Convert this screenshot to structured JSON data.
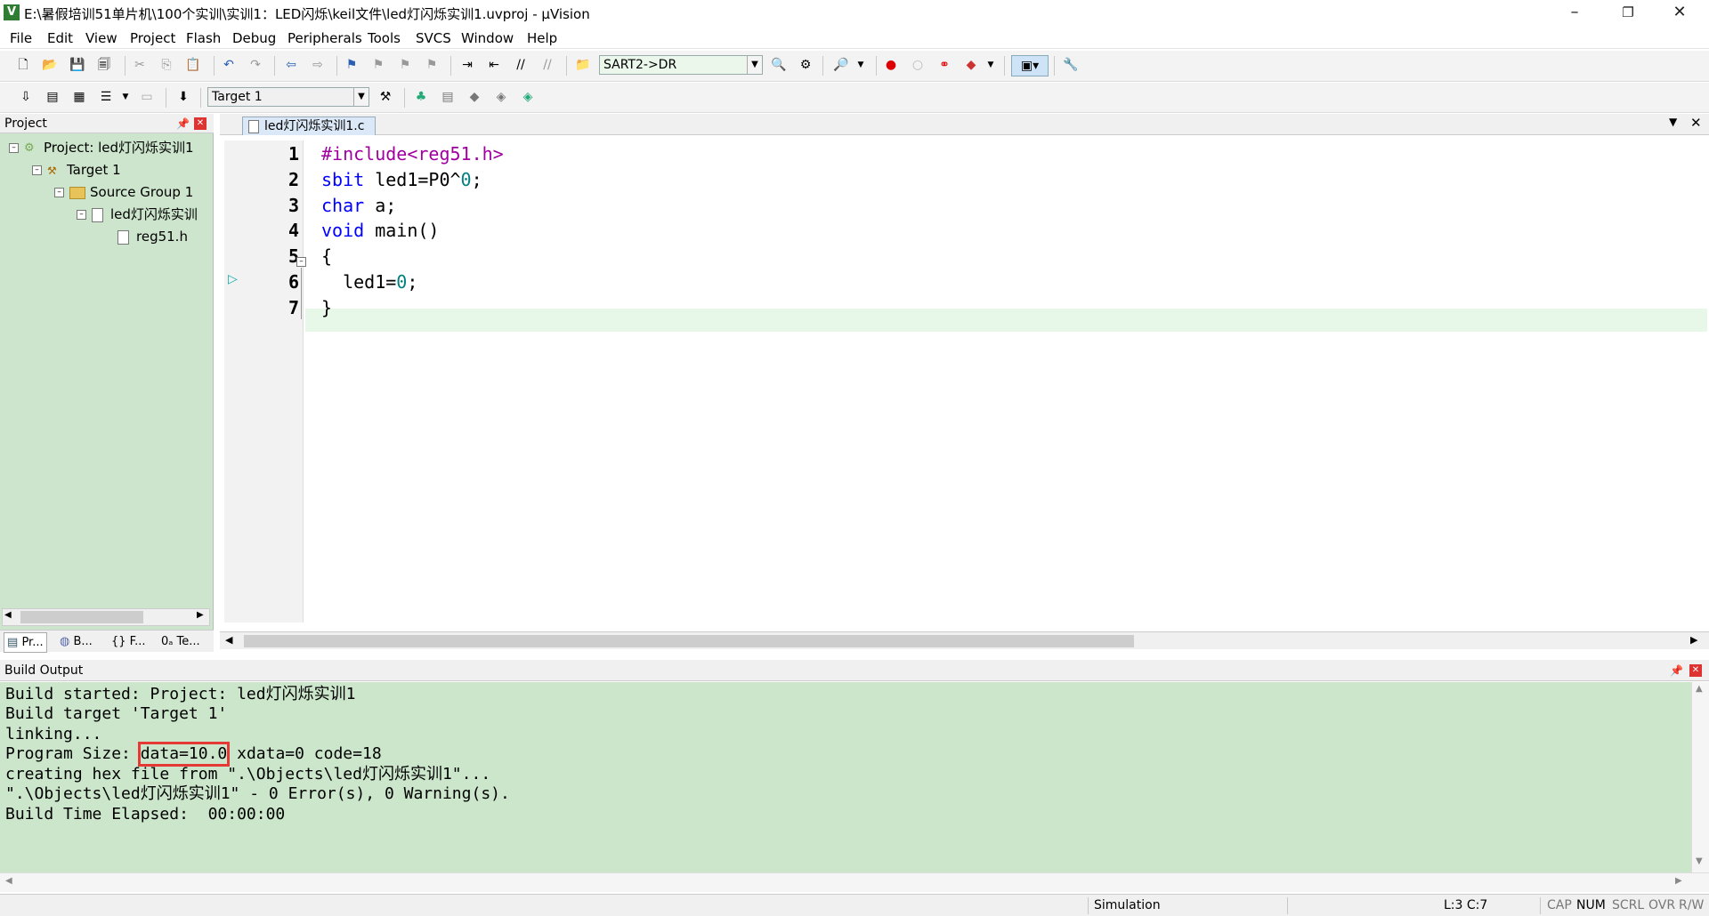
{
  "window": {
    "title": "E:\\暑假培训51单片机\\100个实训\\实训1：LED闪烁\\keil文件\\led灯闪烁实训1.uvproj - µVision",
    "app_icon_glyph": "V",
    "controls": {
      "minimize": "–",
      "maximize": "❐",
      "close": "✕"
    }
  },
  "menu": {
    "items": [
      {
        "label": "File"
      },
      {
        "label": "Edit"
      },
      {
        "label": "View"
      },
      {
        "label": "Project"
      },
      {
        "label": "Flash"
      },
      {
        "label": "Debug"
      },
      {
        "label": "Peripherals"
      },
      {
        "label": "Tools"
      },
      {
        "label": "SVCS"
      },
      {
        "label": "Window"
      },
      {
        "label": "Help"
      }
    ]
  },
  "toolbar1": {
    "find_combo_value": "SART2->DR"
  },
  "toolbar2": {
    "target_combo_value": "Target 1"
  },
  "project_panel": {
    "title": "Project",
    "tree": {
      "project": "Project: led灯闪烁实训1",
      "target": "Target 1",
      "group": "Source Group 1",
      "file": "led灯闪烁实训",
      "header": "reg51.h"
    },
    "tabs": [
      "Pr...",
      "B...",
      "{} F...",
      "0ₐ Te..."
    ]
  },
  "editor": {
    "tab_label": "led灯闪烁实训1.c",
    "line_numbers": [
      "1",
      "2",
      "3",
      "4",
      "5",
      "6",
      "7"
    ],
    "lines": {
      "l1": "#include<reg51.h>",
      "l2_kw": "sbit",
      "l2_rest": " led1=P0^",
      "l2_num": "0",
      "l2_end": ";",
      "l3_kw": "char",
      "l3_rest": " a;",
      "l4_kw": "void",
      "l4_rest": " main()",
      "l5": "{",
      "l6_rest": "  led1=",
      "l6_num": "0",
      "l6_end": ";",
      "l7": "}"
    }
  },
  "build_output": {
    "title": "Build Output",
    "lines": {
      "l1": "Build started: Project: led灯闪烁实训1",
      "l2": "Build target 'Target 1'",
      "l3": "linking...",
      "l4_prefix": "Program Size: ",
      "l4_highlight": "data=10.0",
      "l4_suffix": " xdata=0 code=18",
      "l5": "creating hex file from \".\\Objects\\led灯闪烁实训1\"...",
      "l6": "\".\\Objects\\led灯闪烁实训1\" - 0 Error(s), 0 Warning(s).",
      "l7": "Build Time Elapsed:  00:00:00"
    },
    "highlight_color": "#e53935"
  },
  "status_bar": {
    "mode": "Simulation",
    "cursor": "L:3 C:7",
    "cap": "CAP",
    "num": "NUM",
    "scrl": "SCRL",
    "ovr": "OVR",
    "rw": "R/W"
  }
}
